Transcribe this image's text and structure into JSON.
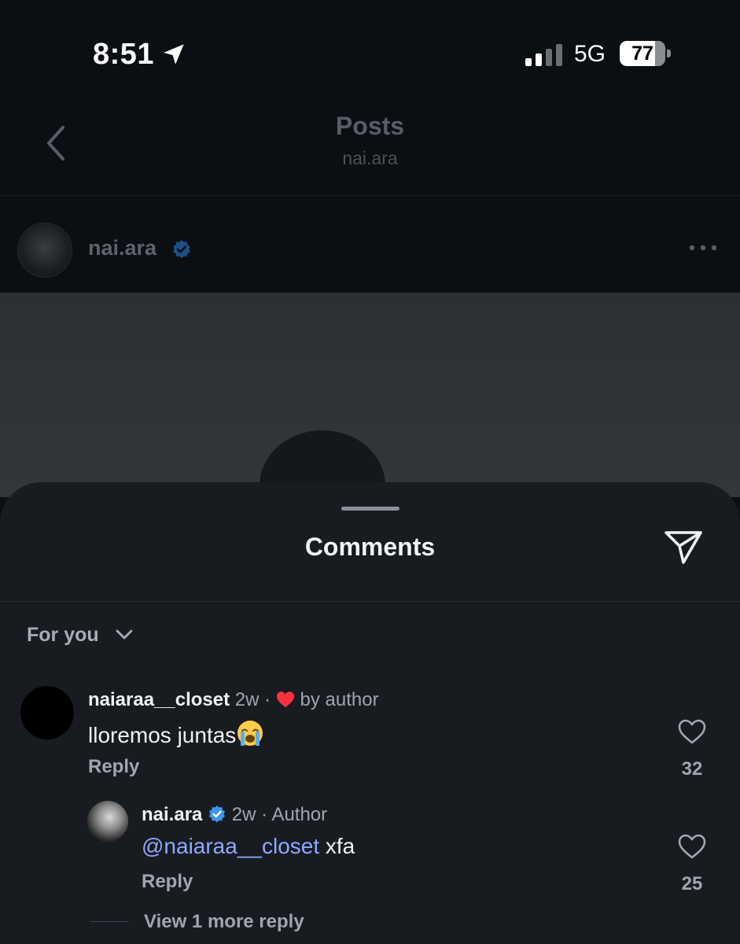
{
  "status": {
    "time": "8:51",
    "network": "5G",
    "battery": "77",
    "battery_fraction": 0.77
  },
  "nav": {
    "title": "Posts",
    "subtitle": "nai.ara"
  },
  "post": {
    "username": "nai.ara"
  },
  "sheet": {
    "title": "Comments",
    "filter": "For you"
  },
  "comments": [
    {
      "username": "naiaraa__closet",
      "time": "2w",
      "separator": "·",
      "liked_by": "by author",
      "text": "lloremos juntas",
      "emoji": "loudly-crying-face",
      "reply_label": "Reply",
      "likes": "32"
    },
    {
      "username": "nai.ara",
      "time": "2w",
      "separator": "·",
      "badge": "Author",
      "mention": "@naiaraa__closet",
      "text": "xfa",
      "reply_label": "Reply",
      "likes": "25"
    }
  ],
  "view_more": "View 1 more reply",
  "colors": {
    "background": "#0b0e12",
    "sheet": "#181c21",
    "verified": "#3897f0",
    "heart_red": "#ff3040",
    "mention": "#8ea9ff"
  }
}
